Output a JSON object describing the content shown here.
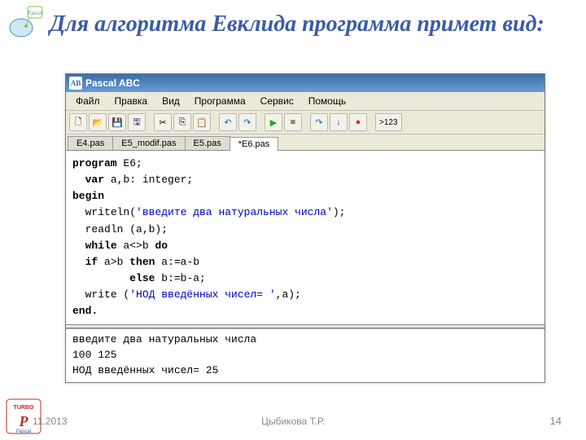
{
  "slide": {
    "title": "Для алгоритма Евклида программа примет вид:",
    "date": "11.2013",
    "author": "Цыбикова Т.Р.",
    "page": "14"
  },
  "window": {
    "title": "Pascal ABC",
    "icon_text": "AB"
  },
  "menu": {
    "file": "Файл",
    "edit": "Правка",
    "view": "Вид",
    "program": "Программа",
    "service": "Сервис",
    "help": "Помощь"
  },
  "toolbar": {
    "new": "🗋",
    "open": "📂",
    "save": "💾",
    "saveall": "🖫",
    "cut": "✂",
    "copy": "⎘",
    "paste": "📋",
    "undo": "↶",
    "redo": "↷",
    "run": "▶",
    "stop": "■",
    "stepover": "↷",
    "stepinto": "↓",
    "breakpoint": "●",
    "more": ">123"
  },
  "tabs": {
    "items": [
      {
        "label": "E4.pas"
      },
      {
        "label": "E5_modif.pas"
      },
      {
        "label": "E5.pas"
      },
      {
        "label": "*E6.pas"
      }
    ]
  },
  "code": {
    "l1a": "program",
    "l1b": " E6;",
    "l2a": "var",
    "l2b": " a,b: integer;",
    "l3": "begin",
    "l4a": "writeln(",
    "l4b": "'введите два натуральных числа'",
    "l4c": ");",
    "l5": "readln (a,b);",
    "l6a": "while",
    "l6b": " a<>b ",
    "l6c": "do",
    "l7a": "if",
    "l7b": " a>b ",
    "l7c": "then",
    "l7d": " a:=a-b",
    "l8a": "else",
    "l8b": " b:=b-a;",
    "l9a": "write (",
    "l9b": "'НОД введённых чисел= '",
    "l9c": ",a);",
    "l10": "end."
  },
  "output": {
    "line1": "введите два натуральных числа",
    "line2": "100 125",
    "line3": "НОД введённых чисел= 25"
  }
}
